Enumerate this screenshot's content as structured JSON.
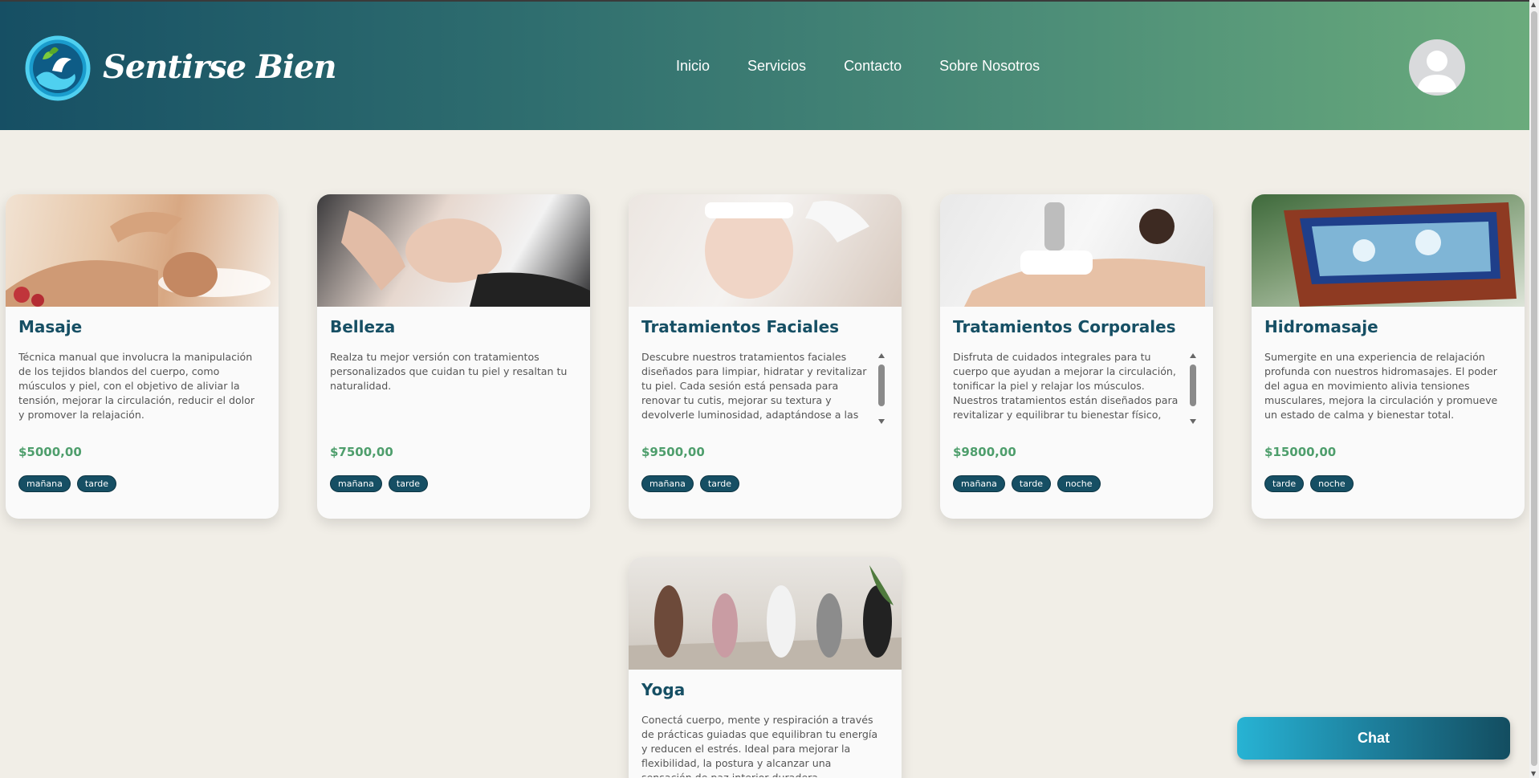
{
  "brand": {
    "name": "Sentirse Bien"
  },
  "nav": [
    {
      "label": "Inicio"
    },
    {
      "label": "Servicios"
    },
    {
      "label": "Contacto"
    },
    {
      "label": "Sobre Nosotros"
    }
  ],
  "services": [
    {
      "title": "Masaje",
      "description": "Técnica manual que involucra la manipulación de los tejidos blandos del cuerpo, como músculos y piel, con el objetivo de aliviar la tensión, mejorar la circulación, reducir el dolor y promover la relajación.",
      "price": "$5000,00",
      "tags": [
        "mañana",
        "tarde"
      ]
    },
    {
      "title": "Belleza",
      "description": "Realza tu mejor versión con tratamientos personalizados que cuidan tu piel y resaltan tu naturalidad.",
      "price": "$7500,00",
      "tags": [
        "mañana",
        "tarde"
      ]
    },
    {
      "title": "Tratamientos Faciales",
      "description": "Descubre nuestros tratamientos faciales diseñados para limpiar, hidratar y revitalizar tu piel. Cada sesión está pensada para renovar tu cutis, mejorar su textura y devolverle luminosidad, adaptándose a las necesidades específicas de tu piel.",
      "price": "$9500,00",
      "tags": [
        "mañana",
        "tarde"
      ]
    },
    {
      "title": "Tratamientos Corporales",
      "description": "Disfruta de cuidados integrales para tu cuerpo que ayudan a mejorar la circulación, tonificar la piel y relajar los músculos. Nuestros tratamientos están diseñados para revitalizar y equilibrar tu bienestar físico, dejándote con una sensación de renovación total.",
      "price": "$9800,00",
      "tags": [
        "mañana",
        "tarde",
        "noche"
      ]
    },
    {
      "title": "Hidromasaje",
      "description": "Sumergite en una experiencia de relajación profunda con nuestros hidromasajes. El poder del agua en movimiento alivia tensiones musculares, mejora la circulación y promueve un estado de calma y bienestar total.",
      "price": "$15000,00",
      "tags": [
        "tarde",
        "noche"
      ]
    },
    {
      "title": "Yoga",
      "description": "Conectá cuerpo, mente y respiración a través de prácticas guiadas que equilibran tu energía y reducen el estrés. Ideal para mejorar la flexibilidad, la postura y alcanzar una sensación de paz interior duradera.",
      "price": "",
      "tags": []
    }
  ],
  "chat": {
    "label": "Chat"
  }
}
